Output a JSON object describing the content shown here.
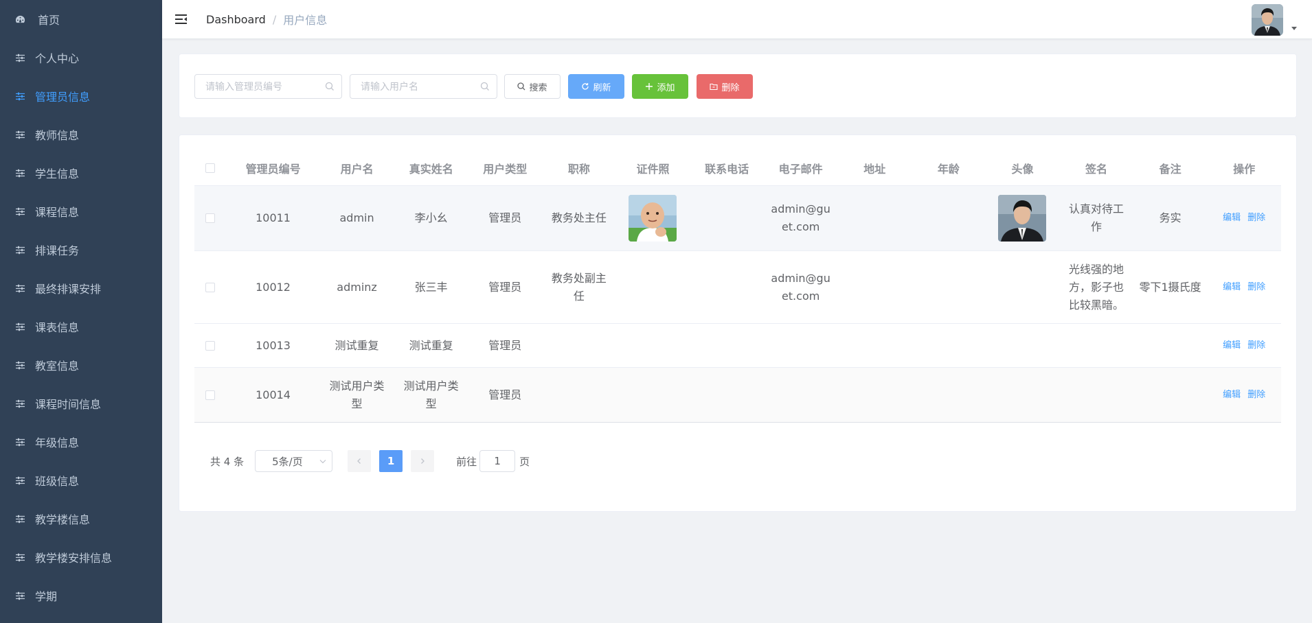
{
  "sidebar": {
    "items": [
      {
        "label": "首页",
        "icon": "dashboard-icon"
      },
      {
        "label": "个人中心",
        "icon": "sliders-icon"
      },
      {
        "label": "管理员信息",
        "icon": "sliders-icon"
      },
      {
        "label": "教师信息",
        "icon": "sliders-icon"
      },
      {
        "label": "学生信息",
        "icon": "sliders-icon"
      },
      {
        "label": "课程信息",
        "icon": "sliders-icon"
      },
      {
        "label": "排课任务",
        "icon": "sliders-icon"
      },
      {
        "label": "最终排课安排",
        "icon": "sliders-icon"
      },
      {
        "label": "课表信息",
        "icon": "sliders-icon"
      },
      {
        "label": "教室信息",
        "icon": "sliders-icon"
      },
      {
        "label": "课程时间信息",
        "icon": "sliders-icon"
      },
      {
        "label": "年级信息",
        "icon": "sliders-icon"
      },
      {
        "label": "班级信息",
        "icon": "sliders-icon"
      },
      {
        "label": "教学楼信息",
        "icon": "sliders-icon"
      },
      {
        "label": "教学楼安排信息",
        "icon": "sliders-icon"
      },
      {
        "label": "学期",
        "icon": "sliders-icon"
      }
    ],
    "active_index": 2
  },
  "navbar": {
    "breadcrumb": [
      "Dashboard",
      "用户信息"
    ],
    "separator": "/"
  },
  "search": {
    "admin_no_placeholder": "请输入管理员编号",
    "username_placeholder": "请输入用户名",
    "search_label": "搜索",
    "refresh_label": "刷新",
    "add_label": "添加",
    "delete_label": "删除"
  },
  "table": {
    "headers": [
      "管理员编号",
      "用户名",
      "真实姓名",
      "用户类型",
      "职称",
      "证件照",
      "联系电话",
      "电子邮件",
      "地址",
      "年龄",
      "头像",
      "签名",
      "备注",
      "操作"
    ],
    "rows": [
      {
        "no": "10011",
        "username": "admin",
        "realname": "李小幺",
        "type": "管理员",
        "title": "教务处主任",
        "id_photo": "baby-photo",
        "phone": "",
        "email": "admin@guet.com",
        "address": "",
        "age": "",
        "avatar": "man-portrait",
        "signature": "认真对待工作",
        "remark": "务实"
      },
      {
        "no": "10012",
        "username": "adminz",
        "realname": "张三丰",
        "type": "管理员",
        "title": "教务处副主任",
        "id_photo": "",
        "phone": "",
        "email": "admin@guet.com",
        "address": "",
        "age": "",
        "avatar": "",
        "signature": "光线强的地方，影子也比较黑暗。",
        "remark": "零下1摄氏度"
      },
      {
        "no": "10013",
        "username": "测试重复",
        "realname": "测试重复",
        "type": "管理员",
        "title": "",
        "id_photo": "",
        "phone": "",
        "email": "",
        "address": "",
        "age": "",
        "avatar": "",
        "signature": "",
        "remark": ""
      },
      {
        "no": "10014",
        "username": "测试用户类型",
        "realname": "测试用户类型",
        "type": "管理员",
        "title": "",
        "id_photo": "",
        "phone": "",
        "email": "",
        "address": "",
        "age": "",
        "avatar": "",
        "signature": "",
        "remark": ""
      }
    ],
    "edit_label": "编辑",
    "delete_label": "删除"
  },
  "pagination": {
    "total_text": "共 4 条",
    "page_size": "5条/页",
    "current_page": "1",
    "goto_prefix": "前往",
    "goto_value": "1",
    "goto_suffix": "页"
  },
  "colors": {
    "sidebar_bg": "#304156",
    "sidebar_text": "#bfcbd9",
    "active": "#409eff",
    "primary": "#66a9f9",
    "success": "#67c23a",
    "danger": "#e96a6a"
  }
}
